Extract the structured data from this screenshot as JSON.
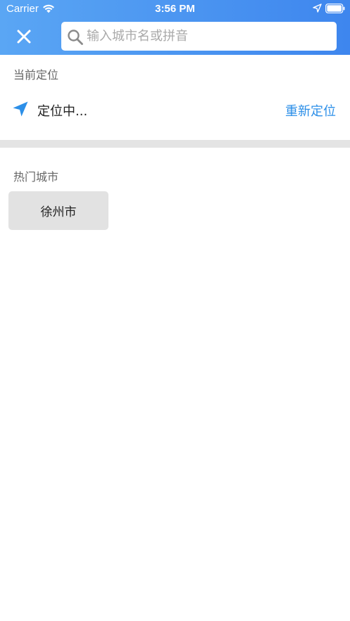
{
  "status_bar": {
    "carrier": "Carrier",
    "time": "3:56 PM"
  },
  "search": {
    "placeholder": "输入城市名或拼音",
    "value": ""
  },
  "current_location": {
    "title": "当前定位",
    "status_text": "定位中...",
    "relocate_label": "重新定位"
  },
  "hot_cities": {
    "title": "热门城市",
    "items": [
      "徐州市"
    ]
  },
  "colors": {
    "header_start": "#5aa6f4",
    "header_end": "#3e86ee",
    "accent": "#2c8fe8"
  },
  "icons": {
    "close": "close-icon",
    "search": "search-icon",
    "locate": "location-arrow-icon"
  }
}
